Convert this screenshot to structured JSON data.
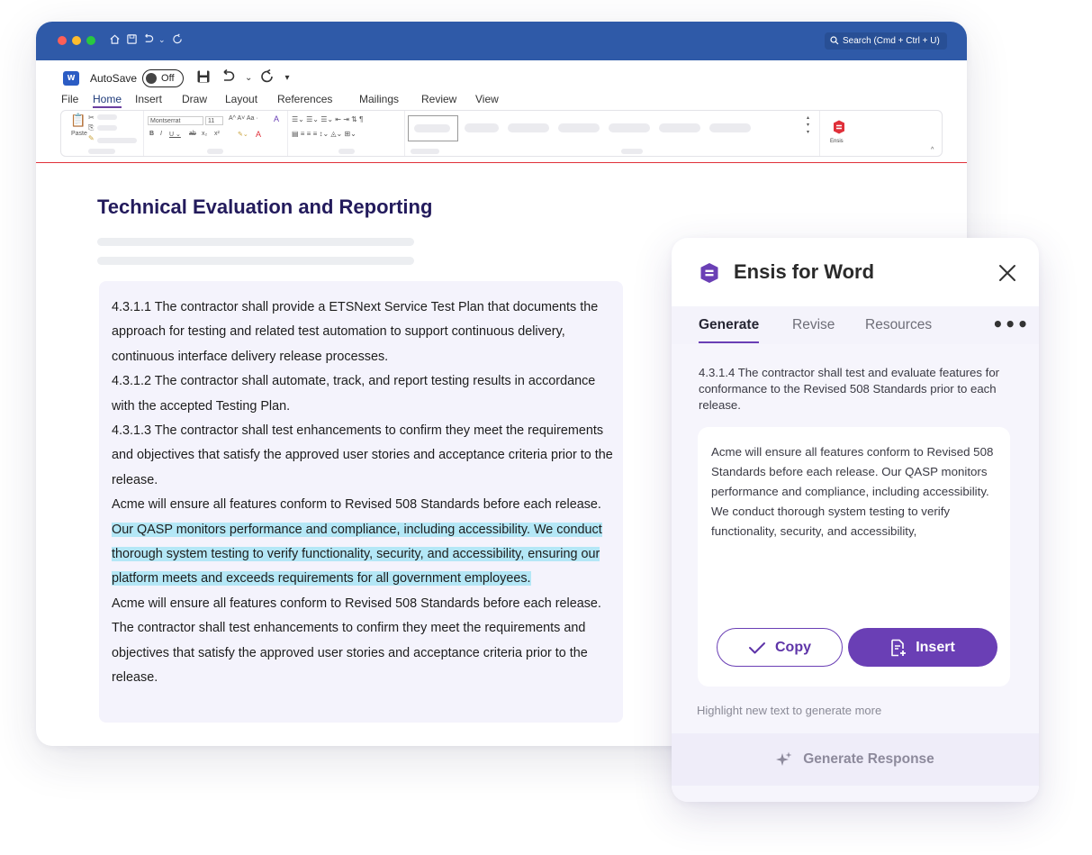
{
  "titlebar": {
    "search_placeholder": "Search (Cmd + Ctrl + U)"
  },
  "quick_access": {
    "autosave_label": "AutoSave",
    "toggle_state": "Off",
    "word_logo": "W"
  },
  "menu": {
    "items": [
      "File",
      "Home",
      "Insert",
      "Draw",
      "Layout",
      "References",
      "Mailings",
      "Review",
      "View"
    ],
    "active": "Home"
  },
  "ribbon": {
    "paste_label": "Paste",
    "font_name": "Montserrat",
    "font_size": "11",
    "ensis_label": "Ensis"
  },
  "document": {
    "title": "Technical Evaluation and Reporting",
    "paragraphs": [
      "4.3.1.1 The contractor shall provide a ETSNext Service Test Plan that documents the approach for testing and related test automation to support continuous delivery, continuous interface delivery release processes.",
      "4.3.1.2 The contractor shall automate, track, and report testing results in accordance with the accepted Testing Plan.",
      "4.3.1.3 The contractor shall test enhancements to confirm they meet the requirements and objectives that satisfy the approved user stories and acceptance criteria prior to the release."
    ],
    "p4_plain": "Acme will ensure all features conform to Revised 508 Standards before each release.",
    "p4_highlight": "Our QASP monitors performance and compliance, including accessibility. We conduct thorough system testing to verify functionality, security, and accessibility, ensuring our platform meets and exceeds requirements for all government employees.",
    "p5": "Acme will ensure all features conform to Revised 508 Standards before each release. The contractor shall test enhancements to confirm they meet the requirements and objectives that satisfy the approved user stories and acceptance criteria prior to the release."
  },
  "ensis": {
    "title": "Ensis for Word",
    "tabs": [
      "Generate",
      "Revise",
      "Resources"
    ],
    "active_tab": "Generate",
    "more_label": "•••",
    "prompt": "4.3.1.4 The contractor shall test and evaluate features for conformance to the Revised 508 Standards prior to each release.",
    "response": "Acme will ensure all features conform to Revised 508 Standards before each release. Our QASP monitors performance and compliance, including accessibility. We conduct thorough system testing to verify functionality, security, and accessibility,",
    "copy_label": "Copy",
    "insert_label": "Insert",
    "hint": "Highlight new text to generate more",
    "generate_label": "Generate Response"
  },
  "colors": {
    "titlebar": "#2f5aa8",
    "brand_purple": "#6a3fb5",
    "highlight": "#b4e7f6",
    "doc_title": "#231b5c",
    "ribbon_accent": "#e0303a"
  }
}
